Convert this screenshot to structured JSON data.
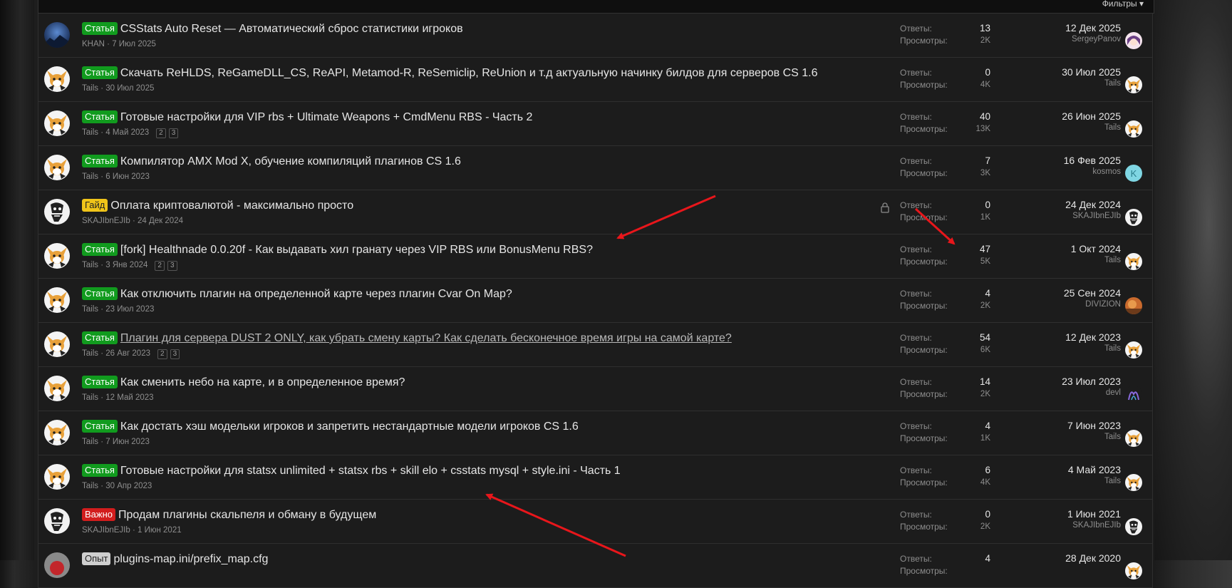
{
  "filters_label": "Фильтры",
  "labels": {
    "replies": "Ответы:",
    "views": "Просмотры:"
  },
  "threads": [
    {
      "prefix": "Статья",
      "prefix_color": "green",
      "title": "CSStats Auto Reset — Автоматический сброс статистики игроков",
      "author": "KHAN",
      "date": "7 Июл 2025",
      "pages": [],
      "replies": "13",
      "views": "2K",
      "last_date": "12 Дек 2025",
      "last_user": "SergeyPanov",
      "avatar": "blue",
      "last_avatar": "anime"
    },
    {
      "prefix": "Статья",
      "prefix_color": "green",
      "title": "Скачать ReHLDS, ReGameDLL_CS, ReAPI, Metamod-R, ReSemiclip, ReUnion и т.д актуальную начинку билдов для серверов CS 1.6",
      "author": "Tails",
      "date": "30 Июл 2025",
      "pages": [],
      "replies": "0",
      "views": "4K",
      "last_date": "30 Июл 2025",
      "last_user": "Tails",
      "avatar": "fox",
      "last_avatar": "fox"
    },
    {
      "prefix": "Статья",
      "prefix_color": "green",
      "title": "Готовые настройки для VIP rbs + Ultimate Weapons + CmdMenu RBS - Часть 2",
      "author": "Tails",
      "date": "4 Май 2023",
      "pages": [
        "2",
        "3"
      ],
      "replies": "40",
      "views": "13K",
      "last_date": "26 Июн 2025",
      "last_user": "Tails",
      "avatar": "fox",
      "last_avatar": "fox"
    },
    {
      "prefix": "Статья",
      "prefix_color": "green",
      "title": "Компилятор AMX Mod X, обучение компиляций плагинов CS 1.6",
      "author": "Tails",
      "date": "6 Июн 2023",
      "pages": [],
      "replies": "7",
      "views": "3K",
      "last_date": "16 Фев 2025",
      "last_user": "kosmos",
      "avatar": "fox",
      "last_avatar": "letter-k"
    },
    {
      "prefix": "Гайд",
      "prefix_color": "yellow",
      "title": "Оплата криптовалютой - максимально просто",
      "author": "SKAJIbnEJIb",
      "date": "24 Дек 2024",
      "pages": [],
      "locked": true,
      "replies": "0",
      "views": "1K",
      "last_date": "24 Дек 2024",
      "last_user": "SKAJIbnEJIb",
      "avatar": "skull",
      "last_avatar": "skull"
    },
    {
      "prefix": "Статья",
      "prefix_color": "green",
      "title": "[fork] Healthnade 0.0.20f - Как выдавать хил гранату через VIP RBS или BonusMenu RBS?",
      "author": "Tails",
      "date": "3 Янв 2024",
      "pages": [
        "2",
        "3"
      ],
      "replies": "47",
      "views": "5K",
      "last_date": "1 Окт 2024",
      "last_user": "Tails",
      "avatar": "fox",
      "last_avatar": "fox"
    },
    {
      "prefix": "Статья",
      "prefix_color": "green",
      "title": "Как отключить плагин на определенной карте через плагин Cvar On Map?",
      "author": "Tails",
      "date": "23 Июл 2023",
      "pages": [],
      "replies": "4",
      "views": "2K",
      "last_date": "25 Сен 2024",
      "last_user": "DIVIZION",
      "avatar": "fox",
      "last_avatar": "orange"
    },
    {
      "prefix": "Статья",
      "prefix_color": "green",
      "title": "Плагин для сервера DUST 2 ONLY, как убрать смену карты? Как сделать бесконечное время игры на самой карте?",
      "visited": true,
      "author": "Tails",
      "date": "26 Авг 2023",
      "pages": [
        "2",
        "3"
      ],
      "replies": "54",
      "views": "6K",
      "last_date": "12 Дек 2023",
      "last_user": "Tails",
      "avatar": "fox",
      "last_avatar": "fox"
    },
    {
      "prefix": "Статья",
      "prefix_color": "green",
      "title": "Как сменить небо на карте, и в определенное время?",
      "author": "Tails",
      "date": "12 Май 2023",
      "pages": [],
      "replies": "14",
      "views": "2K",
      "last_date": "23 Июл 2023",
      "last_user": "devl",
      "avatar": "fox",
      "last_avatar": "purple"
    },
    {
      "prefix": "Статья",
      "prefix_color": "green",
      "title": "Как достать хэш модельки игроков и запретить нестандартные модели игроков CS 1.6",
      "author": "Tails",
      "date": "7 Июн 2023",
      "pages": [],
      "replies": "4",
      "views": "1K",
      "last_date": "7 Июн 2023",
      "last_user": "Tails",
      "avatar": "fox",
      "last_avatar": "fox"
    },
    {
      "prefix": "Статья",
      "prefix_color": "green",
      "title": "Готовые настройки для statsx unlimited + statsx rbs + skill elo + csstats mysql + style.ini - Часть 1",
      "author": "Tails",
      "date": "30 Апр 2023",
      "pages": [],
      "replies": "6",
      "views": "4K",
      "last_date": "4 Май 2023",
      "last_user": "Tails",
      "avatar": "fox",
      "last_avatar": "fox"
    },
    {
      "prefix": "Важно",
      "prefix_color": "red",
      "title": "Продам плагины скальпеля и обману в будущем",
      "author": "SKAJIbnEJIb",
      "date": "1 Июн 2021",
      "pages": [],
      "replies": "0",
      "views": "2K",
      "last_date": "1 Июн 2021",
      "last_user": "SKAJIbnEJIb",
      "avatar": "skull",
      "last_avatar": "skull"
    },
    {
      "prefix": "Опыт",
      "prefix_color": "grey",
      "title": "plugins-map.ini/prefix_map.cfg",
      "author": "",
      "date": "",
      "pages": [],
      "replies": "4",
      "views": "",
      "last_date": "28 Дек 2020",
      "last_user": "",
      "avatar": "red",
      "last_avatar": "fox"
    }
  ],
  "annotation_color": "#e8161b"
}
